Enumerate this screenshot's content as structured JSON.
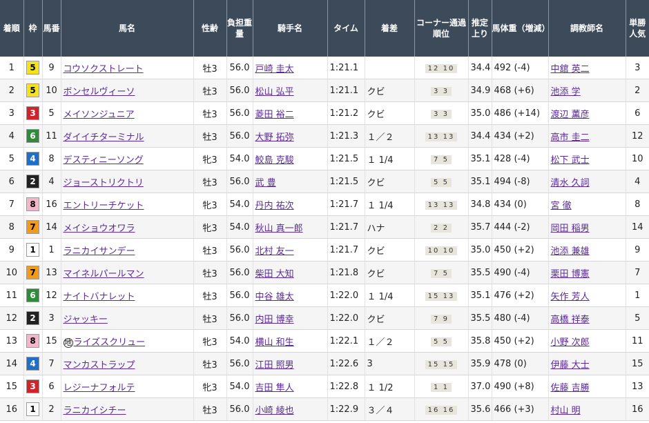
{
  "headers": {
    "rank": "着順",
    "waku": "枠",
    "umaban": "馬番",
    "horse": "馬名",
    "sexage": "性齢",
    "weight": "負担重量",
    "jockey": "騎手名",
    "time": "タイム",
    "margin": "着差",
    "corner": "コーナー通過順位",
    "last3f": "推定上り",
    "body": "馬体重（増減）",
    "trainer": "調教師名",
    "pop": "単勝人気"
  },
  "waku_colors": {
    "1": {
      "bg": "#ffffff",
      "fg": "#000000"
    },
    "2": {
      "bg": "#222222",
      "fg": "#ffffff"
    },
    "3": {
      "bg": "#d2232a",
      "fg": "#ffffff"
    },
    "4": {
      "bg": "#1e6fc8",
      "fg": "#ffffff"
    },
    "5": {
      "bg": "#f4e21b",
      "fg": "#000000"
    },
    "6": {
      "bg": "#2e8b3a",
      "fg": "#ffffff"
    },
    "7": {
      "bg": "#f39a1b",
      "fg": "#000000"
    },
    "8": {
      "bg": "#f6b6c9",
      "fg": "#000000"
    }
  },
  "rows": [
    {
      "rank": "1",
      "waku": "5",
      "umaban": "9",
      "chi": "",
      "horse": "コウソクストレート",
      "sexage": "牡3",
      "weight": "56.0",
      "jockey": "戸崎 圭太",
      "time": "1:21.1",
      "margin": "",
      "corner": "12 10",
      "last3f": "34.4",
      "body": "492 (-4)",
      "trainer": "中舘 英二",
      "pop": "3"
    },
    {
      "rank": "2",
      "waku": "5",
      "umaban": "10",
      "chi": "",
      "horse": "ボンセルヴィーソ",
      "sexage": "牡3",
      "weight": "56.0",
      "jockey": "松山 弘平",
      "time": "1:21.1",
      "margin": "クビ",
      "corner": "3 3",
      "last3f": "34.9",
      "body": "468 (+6)",
      "trainer": "池添 学",
      "pop": "2"
    },
    {
      "rank": "3",
      "waku": "3",
      "umaban": "5",
      "chi": "",
      "horse": "メイソンジュニア",
      "sexage": "牡3",
      "weight": "56.0",
      "jockey": "菱田 裕二",
      "time": "1:21.2",
      "margin": "クビ",
      "corner": "3 3",
      "last3f": "35.0",
      "body": "486 (+14)",
      "trainer": "渡辺 薫彦",
      "pop": "6"
    },
    {
      "rank": "4",
      "waku": "6",
      "umaban": "11",
      "chi": "",
      "horse": "ダイイチターミナル",
      "sexage": "牡3",
      "weight": "56.0",
      "jockey": "大野 拓弥",
      "time": "1:21.3",
      "margin": "１／２",
      "corner": "13 13",
      "last3f": "34.4",
      "body": "434 (+2)",
      "trainer": "高市 圭二",
      "pop": "12"
    },
    {
      "rank": "5",
      "waku": "4",
      "umaban": "8",
      "chi": "",
      "horse": "デスティニーソング",
      "sexage": "牝3",
      "weight": "54.0",
      "jockey": "鮫島 克駿",
      "time": "1:21.5",
      "margin": "１ 1/4",
      "corner": "7 5",
      "last3f": "35.1",
      "body": "428 (-4)",
      "trainer": "松下 武士",
      "pop": "10"
    },
    {
      "rank": "6",
      "waku": "2",
      "umaban": "4",
      "chi": "",
      "horse": "ジョーストリクトリ",
      "sexage": "牡3",
      "weight": "56.0",
      "jockey": "武 豊",
      "time": "1:21.5",
      "margin": "クビ",
      "corner": "5 5",
      "last3f": "35.1",
      "body": "494 (-8)",
      "trainer": "清水 久詞",
      "pop": "4"
    },
    {
      "rank": "7",
      "waku": "8",
      "umaban": "16",
      "chi": "",
      "horse": "エントリーチケット",
      "sexage": "牝3",
      "weight": "54.0",
      "jockey": "丹内 祐次",
      "time": "1:21.7",
      "margin": "１ 1/4",
      "corner": "13 13",
      "last3f": "34.8",
      "body": "434 (0)",
      "trainer": "宮 徹",
      "pop": "8"
    },
    {
      "rank": "8",
      "waku": "7",
      "umaban": "14",
      "chi": "",
      "horse": "メイショウオワラ",
      "sexage": "牝3",
      "weight": "54.0",
      "jockey": "秋山 真一郎",
      "time": "1:21.7",
      "margin": "ハナ",
      "corner": "2 2",
      "last3f": "35.7",
      "body": "444 (-2)",
      "trainer": "岡田 稲男",
      "pop": "14"
    },
    {
      "rank": "9",
      "waku": "1",
      "umaban": "1",
      "chi": "",
      "horse": "ラニカイサンデー",
      "sexage": "牡3",
      "weight": "56.0",
      "jockey": "北村 友一",
      "time": "1:21.7",
      "margin": "クビ",
      "corner": "10 10",
      "last3f": "35.0",
      "body": "450 (+2)",
      "trainer": "池添 兼雄",
      "pop": "9"
    },
    {
      "rank": "10",
      "waku": "7",
      "umaban": "13",
      "chi": "",
      "horse": "マイネルパールマン",
      "sexage": "牡3",
      "weight": "56.0",
      "jockey": "柴田 大知",
      "time": "1:21.8",
      "margin": "クビ",
      "corner": "7 5",
      "last3f": "35.5",
      "body": "490 (-4)",
      "trainer": "栗田 博憲",
      "pop": "7"
    },
    {
      "rank": "11",
      "waku": "6",
      "umaban": "12",
      "chi": "",
      "horse": "ナイトバナレット",
      "sexage": "牡3",
      "weight": "56.0",
      "jockey": "中谷 雄太",
      "time": "1:22.0",
      "margin": "１ 1/4",
      "corner": "15 13",
      "last3f": "35.1",
      "body": "476 (+2)",
      "trainer": "矢作 芳人",
      "pop": "1"
    },
    {
      "rank": "12",
      "waku": "2",
      "umaban": "3",
      "chi": "",
      "horse": "ジャッキー",
      "sexage": "牡3",
      "weight": "56.0",
      "jockey": "内田 博幸",
      "time": "1:22.0",
      "margin": "クビ",
      "corner": "7 9",
      "last3f": "35.5",
      "body": "480 (-4)",
      "trainer": "高橋 祥泰",
      "pop": "5"
    },
    {
      "rank": "13",
      "waku": "8",
      "umaban": "15",
      "chi": "地",
      "horse": "ライズスクリュー",
      "sexage": "牝3",
      "weight": "54.0",
      "jockey": "横山 和生",
      "time": "1:22.1",
      "margin": "１／２",
      "corner": "5 5",
      "last3f": "35.8",
      "body": "450 (+2)",
      "trainer": "小野 次郎",
      "pop": "11"
    },
    {
      "rank": "14",
      "waku": "4",
      "umaban": "7",
      "chi": "",
      "horse": "マンカストラップ",
      "sexage": "牡3",
      "weight": "56.0",
      "jockey": "江田 照男",
      "time": "1:22.6",
      "margin": "3",
      "corner": "15 15",
      "last3f": "35.9",
      "body": "478 (0)",
      "trainer": "伊藤 大士",
      "pop": "15"
    },
    {
      "rank": "15",
      "waku": "3",
      "umaban": "6",
      "chi": "",
      "horse": "レジーナフォルテ",
      "sexage": "牝3",
      "weight": "54.0",
      "jockey": "吉田 隼人",
      "time": "1:22.8",
      "margin": "１ 1/2",
      "corner": "1 1",
      "last3f": "37.0",
      "body": "490 (+8)",
      "trainer": "佐藤 吉勝",
      "pop": "13"
    },
    {
      "rank": "16",
      "waku": "1",
      "umaban": "2",
      "chi": "",
      "horse": "ラニカイシチー",
      "sexage": "牡3",
      "weight": "56.0",
      "jockey": "小崎 綾也",
      "time": "1:22.9",
      "margin": "３／４",
      "corner": "16 16",
      "last3f": "35.6",
      "body": "466 (+3)",
      "trainer": "村山 明",
      "pop": "16"
    }
  ]
}
